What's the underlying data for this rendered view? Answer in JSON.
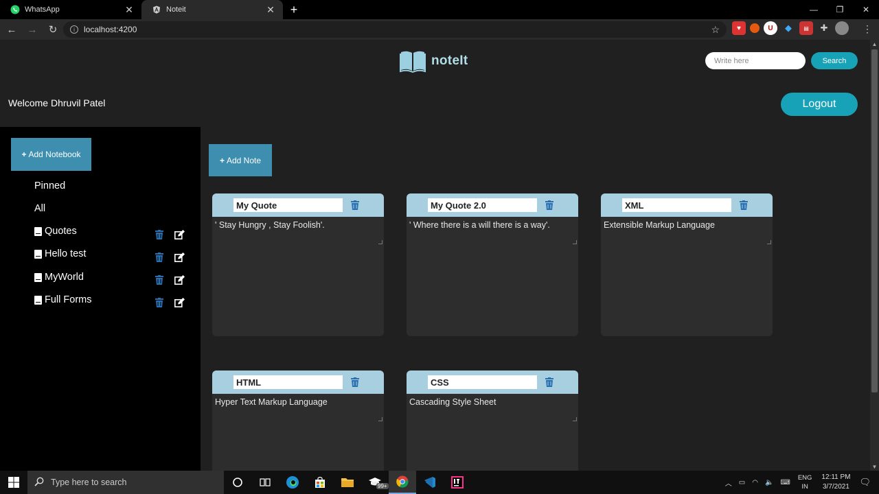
{
  "browser": {
    "tabs": [
      {
        "title": "WhatsApp",
        "active": false
      },
      {
        "title": "Noteit",
        "active": true
      }
    ],
    "url": "localhost:4200"
  },
  "header": {
    "logo_text": "noteIt",
    "search_placeholder": "Write here",
    "search_label": "Search",
    "welcome": "Welcome Dhruvil Patel",
    "logout_label": "Logout"
  },
  "sidebar": {
    "add_notebook_label": "Add Notebook",
    "pinned_label": "Pinned",
    "all_label": "All",
    "notebooks": [
      {
        "name": "Quotes"
      },
      {
        "name": "Hello test"
      },
      {
        "name": "MyWorld"
      },
      {
        "name": "Full Forms"
      }
    ]
  },
  "main": {
    "add_note_label": "Add Note",
    "notes": [
      {
        "title": "My Quote",
        "body": "' Stay Hungry , Stay Foolish'."
      },
      {
        "title": "My Quote 2.0",
        "body": "' Where there is a will there is a way'."
      },
      {
        "title": "XML",
        "body": "Extensible Markup Language"
      },
      {
        "title": "HTML",
        "body": "Hyper Text Markup Language"
      },
      {
        "title": "CSS",
        "body": "Cascading Style Sheet"
      }
    ]
  },
  "taskbar": {
    "search_placeholder": "Type here to search",
    "badge": "99+",
    "lang_top": "ENG",
    "lang_bottom": "IN",
    "time": "12:11 PM",
    "date": "3/7/2021"
  },
  "colors": {
    "accent": "#17a2b8",
    "button_blue": "#3e8eaf",
    "card_header": "#a8cfe0",
    "delete_icon": "#2a6fb0"
  }
}
